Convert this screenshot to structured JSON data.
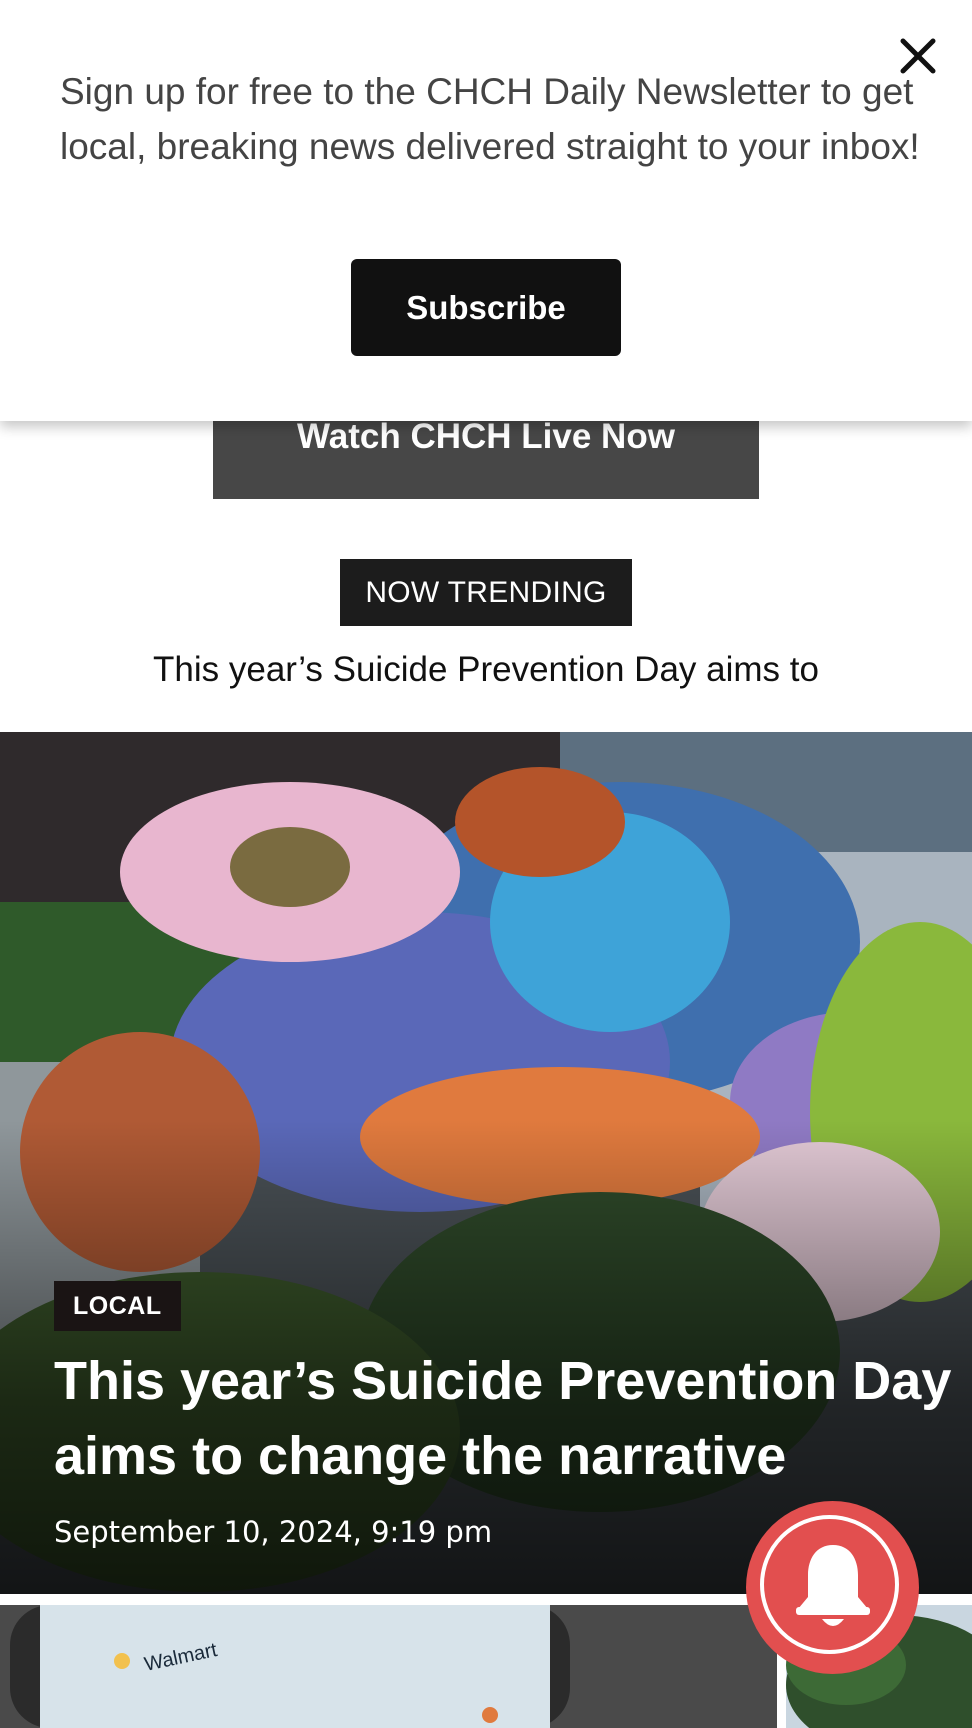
{
  "newsletter_popup": {
    "message": "Sign up for free to the CHCH Daily Newsletter to get local, breaking news delivered straight to your inbox!",
    "subscribe_label": "Subscribe",
    "close_icon": "close-icon"
  },
  "watch_live": {
    "label": "Watch CHCH Live Now"
  },
  "trending": {
    "badge": "NOW TRENDING",
    "headline": "This year’s Suicide Prevention Day aims to"
  },
  "hero_article": {
    "category": "LOCAL",
    "title": "This year’s Suicide Prevention Day aims to change the narrative",
    "date": "September 10, 2024, 9:19 pm"
  },
  "thumbnails": {
    "left_caption": "Walmart"
  },
  "notification": {
    "icon": "bell-icon",
    "color": "#e24f4f"
  }
}
